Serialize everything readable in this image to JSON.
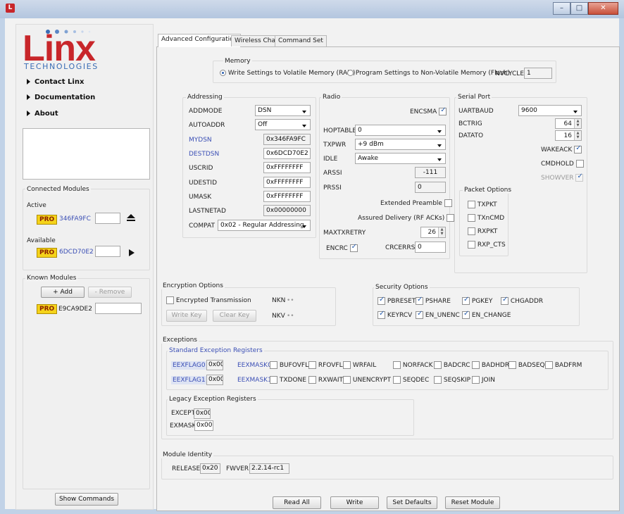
{
  "window": {
    "icon_letter": "L"
  },
  "logo": {
    "brand": "Linx",
    "sub": "TECHNOLOGIES",
    "brand_color": "#c8262a",
    "sub_color": "#3a6db5"
  },
  "nav": [
    {
      "label": "Contact Linx"
    },
    {
      "label": "Documentation"
    },
    {
      "label": "About"
    }
  ],
  "connected": {
    "title": "Connected Modules",
    "active_label": "Active",
    "active_badge": "PRO",
    "active_id": "346FA9FC",
    "available_label": "Available",
    "available_badge": "PRO",
    "available_id": "6DCD70E2"
  },
  "known": {
    "title": "Known Modules",
    "add": "+ Add",
    "remove": "- Remove",
    "badge": "PRO",
    "id": "E9CA9DE2"
  },
  "show_commands": "Show Commands",
  "tabs": [
    "Advanced Configuration",
    "Wireless Chat",
    "Command Set"
  ],
  "memory": {
    "title": "Memory",
    "opt1": "Write Settings to Volatile Memory (RAM)",
    "opt2": "Program Settings to Non-Volatile Memory (Flash)",
    "nvcycle_label": "NVCYCLE",
    "nvcycle_value": "1"
  },
  "addressing": {
    "title": "Addressing",
    "addmode_label": "ADDMODE",
    "addmode_value": "DSN",
    "autoaddr_label": "AUTOADDR",
    "autoaddr_value": "Off",
    "mydsn_label": "MYDSN",
    "mydsn_value": "0x346FA9FC",
    "destdsn_label": "DESTDSN",
    "destdsn_value": "0x6DCD70E2",
    "uscrid_label": "USCRID",
    "uscrid_value": "0xFFFFFFFF",
    "udestid_label": "UDESTID",
    "udestid_value": "0xFFFFFFFF",
    "umask_label": "UMASK",
    "umask_value": "0xFFFFFFFF",
    "lastnetad_label": "LASTNETAD",
    "lastnetad_value": "0x00000000",
    "compat_label": "COMPAT",
    "compat_value": "0x02 - Regular Addressing"
  },
  "radio": {
    "title": "Radio",
    "encsma": "ENCSMA",
    "hoptable_label": "HOPTABLE",
    "hoptable_value": "0",
    "txpwr_label": "TXPWR",
    "txpwr_value": "+9 dBm",
    "idle_label": "IDLE",
    "idle_value": "Awake",
    "arssi_label": "ARSSI",
    "arssi_value": "-111",
    "prssi_label": "PRSSI",
    "prssi_value": "0",
    "ext_preamble": "Extended Preamble",
    "assured": "Assured Delivery (RF ACKs)",
    "maxtxretry_label": "MAXTXRETRY",
    "maxtxretry_value": "26",
    "encrc": "ENCRC",
    "crcerrs_label": "CRCERRS",
    "crcerrs_value": "0"
  },
  "serial": {
    "title": "Serial Port",
    "uartbaud_label": "UARTBAUD",
    "uartbaud_value": "9600",
    "bctrig_label": "BCTRIG",
    "bctrig_value": "64",
    "datato_label": "DATATO",
    "datato_value": "16",
    "wakeack": "WAKEACK",
    "cmdhold": "CMDHOLD",
    "showver": "SHOWVER"
  },
  "packet": {
    "title": "Packet Options",
    "txpkt": "TXPKT",
    "txncmd": "TXnCMD",
    "rxpkt": "RXPKT",
    "rxpcts": "RXP_CTS"
  },
  "encryption": {
    "title": "Encryption Options",
    "enc_tx": "Encrypted Transmission",
    "nkn": "NKN",
    "nkn_val": "••",
    "write_key": "Write Key",
    "clear_key": "Clear Key",
    "nkv": "NKV",
    "nkv_val": "••"
  },
  "security": {
    "title": "Security Options",
    "items": [
      "PBRESET",
      "PSHARE",
      "PGKEY",
      "CHGADDR",
      "KEYRCV",
      "EN_UNENC",
      "EN_CHANGE"
    ]
  },
  "exceptions": {
    "title": "Exceptions",
    "std_title": "Standard Exception Registers",
    "eexflag0": "EEXFLAG0",
    "eexflag0_val": "0x00",
    "eexmask0": "EEXMASK0",
    "mask0": [
      "BUFOVFL",
      "RFOVFL",
      "WRFAIL",
      "NORFACK",
      "BADCRC",
      "BADHDR",
      "BADSEQ",
      "BADFRM"
    ],
    "eexflag1": "EEXFLAG1",
    "eexflag1_val": "0x00",
    "eexmask1": "EEXMASK1",
    "mask1": [
      "TXDONE",
      "RXWAIT",
      "UNENCRYPT",
      "SEQDEC",
      "SEQSKIP",
      "JOIN"
    ],
    "legacy_title": "Legacy Exception Registers",
    "except_label": "EXCEPT",
    "except_val": "0x00",
    "exmask_label": "EXMASK",
    "exmask_val": "0x00"
  },
  "identity": {
    "title": "Module Identity",
    "release_label": "RELEASE",
    "release_val": "0x20",
    "fwver_label": "FWVER",
    "fwver_val": "2.2.14-rc1"
  },
  "actions": {
    "read_all": "Read All",
    "write": "Write",
    "set_defaults": "Set Defaults",
    "reset_module": "Reset Module"
  }
}
